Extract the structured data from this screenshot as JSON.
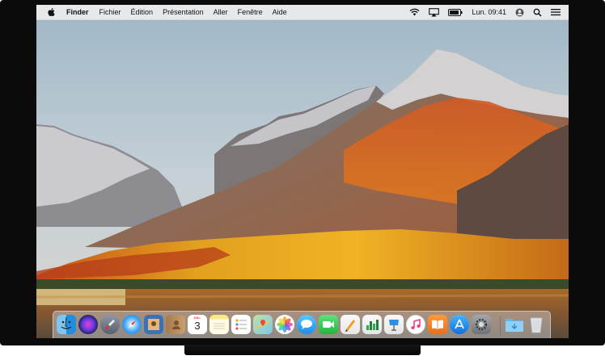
{
  "menubar": {
    "app_name": "Finder",
    "menus": [
      "Fichier",
      "Édition",
      "Présentation",
      "Aller",
      "Fenêtre",
      "Aide"
    ],
    "clock": "Lun. 09:41",
    "status_icons": [
      "wifi-icon",
      "airplay-icon",
      "battery-icon",
      "user-icon",
      "search-icon",
      "menu-list-icon"
    ]
  },
  "dock": {
    "apps": [
      {
        "name": "finder",
        "icon": "finder-icon"
      },
      {
        "name": "siri",
        "icon": "siri-icon"
      },
      {
        "name": "launchpad",
        "icon": "rocket-icon"
      },
      {
        "name": "safari",
        "icon": "compass-icon"
      },
      {
        "name": "photo-booth",
        "icon": "photo-booth-icon"
      },
      {
        "name": "contacts",
        "icon": "contacts-icon"
      },
      {
        "name": "calendar",
        "icon": "calendar-icon"
      },
      {
        "name": "notes",
        "icon": "notes-icon"
      },
      {
        "name": "reminders",
        "icon": "reminders-icon"
      },
      {
        "name": "maps",
        "icon": "maps-icon"
      },
      {
        "name": "photos",
        "icon": "photos-icon"
      },
      {
        "name": "messages",
        "icon": "messages-icon"
      },
      {
        "name": "facetime",
        "icon": "facetime-icon"
      },
      {
        "name": "pages",
        "icon": "pages-icon"
      },
      {
        "name": "numbers",
        "icon": "numbers-icon"
      },
      {
        "name": "keynote",
        "icon": "keynote-icon"
      },
      {
        "name": "music",
        "icon": "music-icon"
      },
      {
        "name": "books",
        "icon": "books-icon"
      },
      {
        "name": "app-store",
        "icon": "app-store-icon"
      },
      {
        "name": "system-preferences",
        "icon": "gear-icon"
      }
    ],
    "calendar": {
      "month": "JUIL.",
      "day": "3"
    },
    "extras": [
      {
        "name": "downloads-folder",
        "icon": "folder-icon"
      },
      {
        "name": "trash",
        "icon": "trash-icon"
      }
    ]
  },
  "colors": {
    "menubar": "#ececec",
    "frame": "#0b0b0b",
    "accent": "#1e88e5"
  }
}
